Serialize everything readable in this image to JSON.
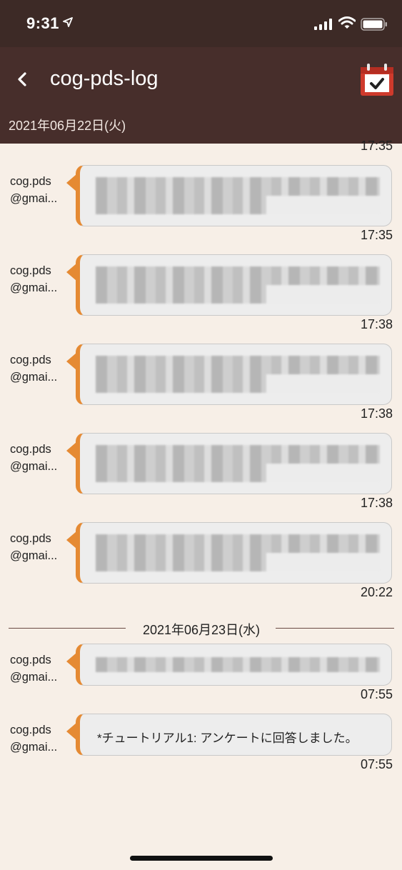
{
  "status_bar": {
    "time": "9:31"
  },
  "header": {
    "title": "cog-pds-log",
    "date": "2021年06月22日(火)"
  },
  "icons": {
    "back": "chevron-left-icon",
    "calendar": "calendar-check-icon",
    "location": "location-arrow-icon",
    "signal": "cellular-signal-icon",
    "wifi": "wifi-icon",
    "battery": "battery-icon"
  },
  "colors": {
    "status_bar_bg": "#3d2a26",
    "header_bg": "#472e2b",
    "accent": "#e58a33",
    "page_bg": "#f7efe7"
  },
  "top_partial_time": "17:35",
  "messages": [
    {
      "sender_line1": "cog.pds",
      "sender_line2": "@gmai...",
      "text": "",
      "time": "17:35"
    },
    {
      "sender_line1": "cog.pds",
      "sender_line2": "@gmai...",
      "text": "",
      "time": "17:38"
    },
    {
      "sender_line1": "cog.pds",
      "sender_line2": "@gmai...",
      "text": "",
      "time": "17:38"
    },
    {
      "sender_line1": "cog.pds",
      "sender_line2": "@gmai...",
      "text": "",
      "time": "17:38"
    },
    {
      "sender_line1": "cog.pds",
      "sender_line2": "@gmai...",
      "text": "",
      "time": "20:22"
    },
    {
      "sender_line1": "cog.pds",
      "sender_line2": "@gmai...",
      "text": "",
      "time": "07:55"
    },
    {
      "sender_line1": "cog.pds",
      "sender_line2": "@gmai...",
      "text": "*チュートリアル1: アンケートに回答しました。",
      "time": "07:55"
    }
  ],
  "date_divider": "2021年06月23日(水)"
}
